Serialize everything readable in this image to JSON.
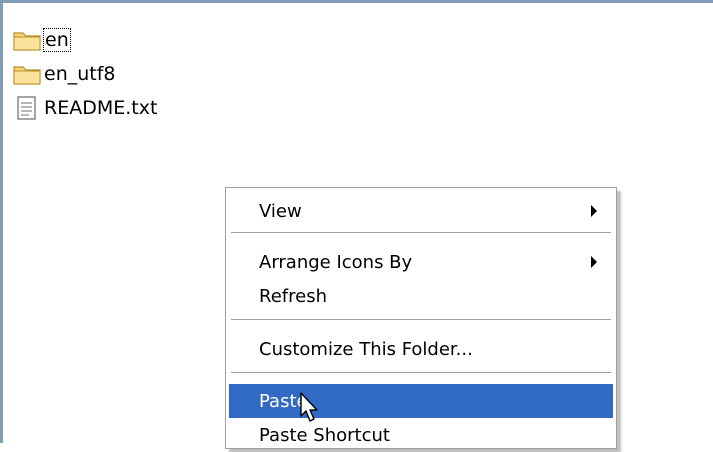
{
  "files": [
    {
      "name": "en",
      "icon": "folder-icon",
      "focused": true
    },
    {
      "name": "en_utf8",
      "icon": "folder-icon",
      "focused": false
    },
    {
      "name": "README.txt",
      "icon": "text-file-icon",
      "focused": false
    }
  ],
  "context_menu": {
    "items": [
      {
        "label": "View",
        "submenu": true
      },
      {
        "label": "Arrange Icons By",
        "submenu": true
      },
      {
        "label": "Refresh",
        "submenu": false
      },
      {
        "label": "Customize This Folder...",
        "submenu": false
      },
      {
        "label": "Paste",
        "submenu": false,
        "highlighted": true
      },
      {
        "label": "Paste Shortcut",
        "submenu": false
      }
    ]
  },
  "colors": {
    "highlight": "#316ac5",
    "border": "#7f9db9",
    "folder": "#f7d774"
  }
}
